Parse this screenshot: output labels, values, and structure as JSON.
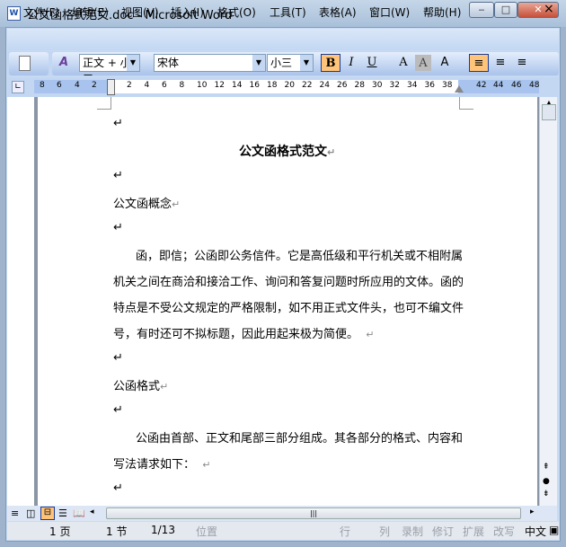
{
  "window": {
    "title": "公文函格式范文.doc - Microsoft Word",
    "minimize": "‒",
    "maximize": "□",
    "close": "✕"
  },
  "menu": [
    "文件(F)",
    "编辑(E)",
    "视图(V)",
    "插入(I)",
    "格式(O)",
    "工具(T)",
    "表格(A)",
    "窗口(W)",
    "帮助(H)"
  ],
  "menu_close": "×",
  "toolbar": {
    "style": "正文 + 小三",
    "font": "宋体",
    "size": "小三",
    "bold": "B",
    "italic": "I",
    "underline": "U",
    "charborder": "A",
    "charshade": "A",
    "phonetic": "A"
  },
  "ruler": {
    "left_ticks": [
      "8",
      "6",
      "4",
      "2"
    ],
    "ticks": [
      "2",
      "4",
      "6",
      "8",
      "10",
      "12",
      "14",
      "16",
      "18",
      "20",
      "22",
      "24",
      "26",
      "28",
      "30",
      "32",
      "34",
      "36",
      "38"
    ],
    "right_ticks": [
      "42",
      "44",
      "46",
      "48"
    ]
  },
  "document": {
    "title": "公文函格式范文",
    "mark": "↵",
    "h1": "公文函概念",
    "p1": [
      "函，即信；公函即公务信件。它是高低级和平行机关或不相附属",
      "机关之间在商洽和接洽工作、询问和答复问题时所应用的文体。函的",
      "特点是不受公文规定的严格限制，如不用正式文件头，也可不编文件",
      "号，有时还可不拟标题，因此用起来极为简便。"
    ],
    "h2": "公函格式",
    "p2": [
      "公函由首部、正文和尾部三部分组成。其各部分的格式、内容和",
      "写法请求如下："
    ]
  },
  "status": {
    "page": "1 页",
    "section": "1 节",
    "pages": "1/13",
    "position": "位置",
    "line": "行",
    "col": "列",
    "rec": "录制",
    "trk": "修订",
    "ext": "扩展",
    "ovr": "改写",
    "lang": "中文"
  }
}
